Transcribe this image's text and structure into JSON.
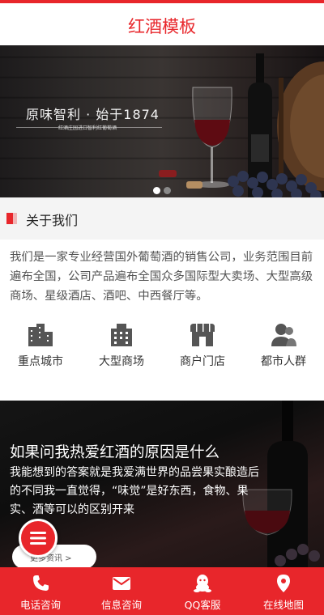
{
  "header": {
    "title": "红酒模板"
  },
  "banner": {
    "slogan": "原味智利 · 始于1874",
    "subtitle": "红酒庄园进口智利红葡萄酒",
    "slides_total": 2,
    "active_slide": 1
  },
  "about": {
    "heading": "关于我们",
    "body": "我们是一家专业经营国外葡萄酒的销售公司，业务范围目前遍布全国，公司产品遍布全国众多国际型大卖场、大型高级商场、星级酒店、酒吧、中西餐厅等。"
  },
  "features": [
    {
      "label": "重点城市",
      "icon": "city-buildings-icon"
    },
    {
      "label": "大型商场",
      "icon": "office-building-icon"
    },
    {
      "label": "商户门店",
      "icon": "storefront-icon"
    },
    {
      "label": "都市人群",
      "icon": "people-icon"
    }
  ],
  "promo": {
    "title": "如果问我热爱红酒的原因是什么",
    "body": "我能想到的答案就是我爱满世界的品尝果实酿造后的不同我一直觉得，“味觉”是好东西，食物、果实、酒等可以的区别开来",
    "more_label": "更多资讯 >"
  },
  "bottom_nav": [
    {
      "label": "电话咨询",
      "icon": "phone-icon"
    },
    {
      "label": "信息咨询",
      "icon": "mail-icon"
    },
    {
      "label": "QQ客服",
      "icon": "qq-icon"
    },
    {
      "label": "在线地图",
      "icon": "map-pin-icon"
    }
  ],
  "colors": {
    "accent": "#e8262b",
    "section_bg": "#f4f4f4",
    "text": "#555555"
  }
}
